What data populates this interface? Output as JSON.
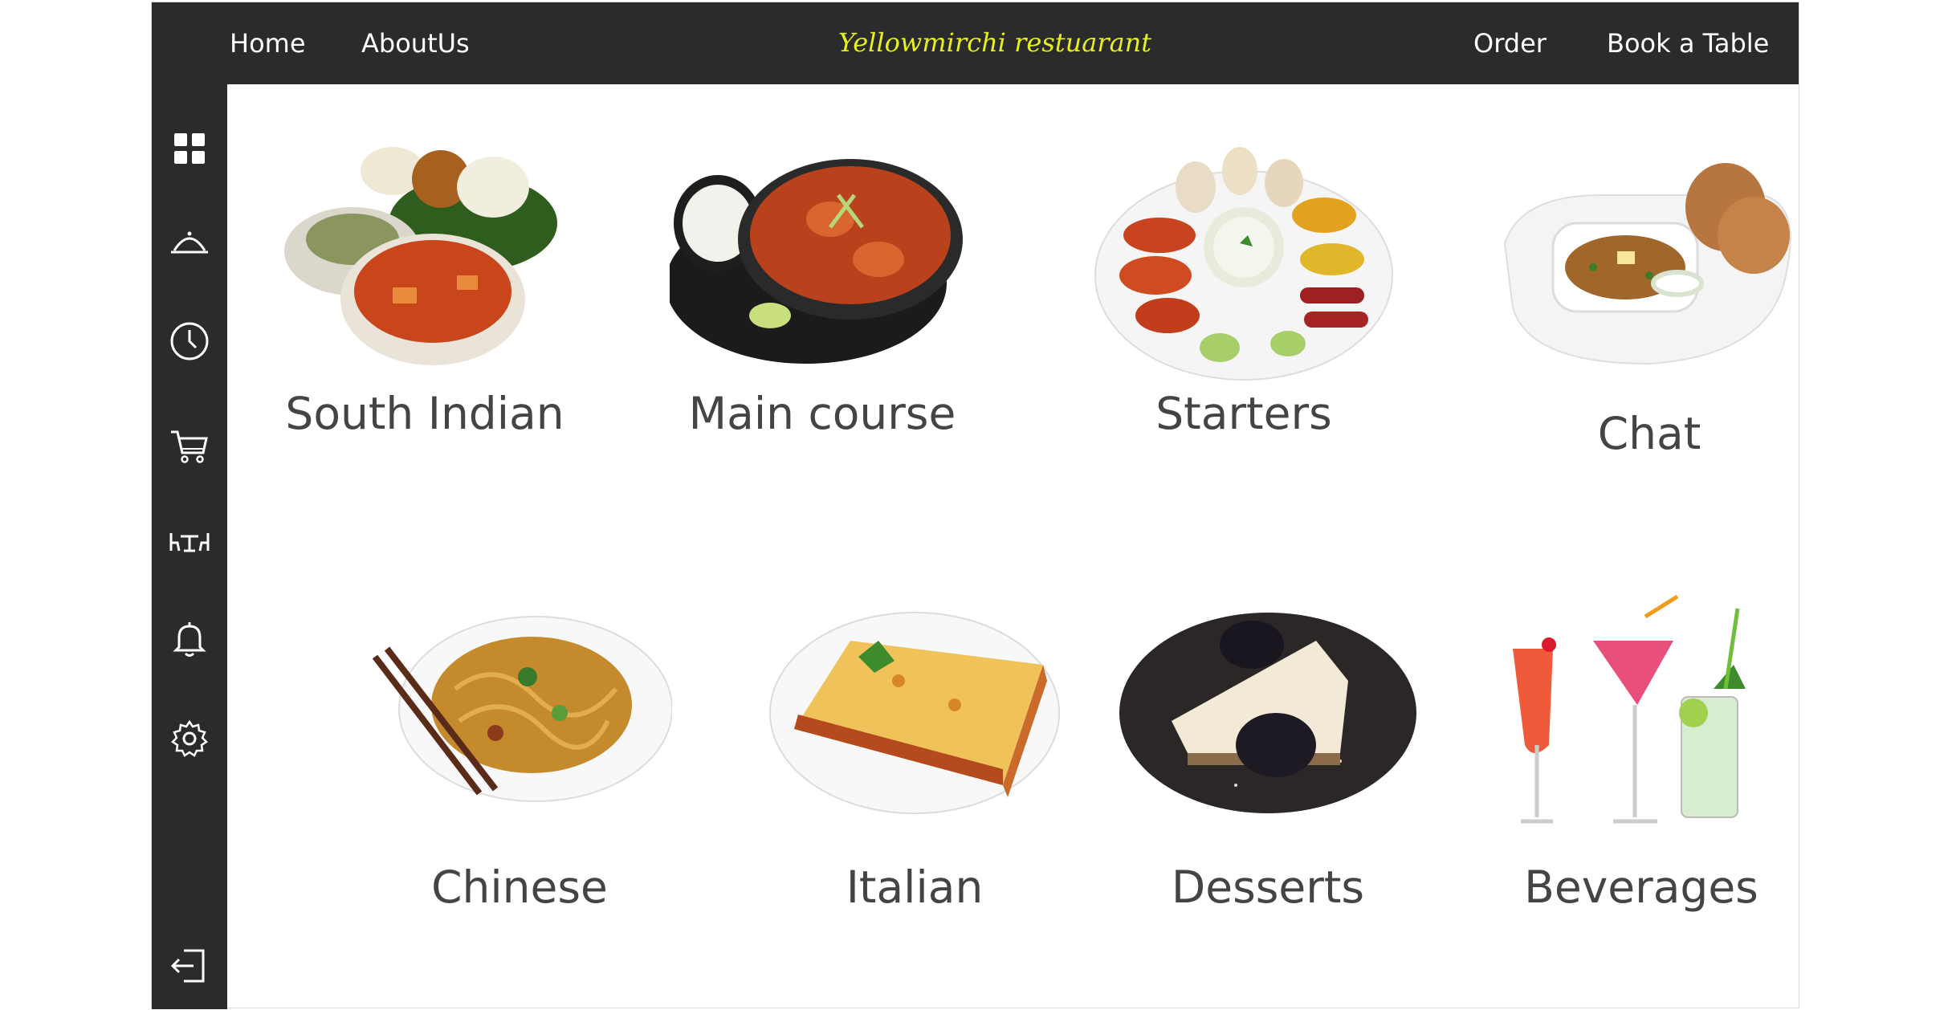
{
  "topbar": {
    "left_links": [
      "Home",
      "AboutUs"
    ],
    "brand": "Yellowmirchi restuarant",
    "right_links": [
      "Order",
      "Book a Table"
    ]
  },
  "sidebar": {
    "icons": [
      "grid-icon",
      "cloche-icon",
      "clock-icon",
      "cart-icon",
      "table-icon",
      "bell-icon",
      "gear-icon"
    ],
    "bottom_icon": "sign-out-icon"
  },
  "menu": {
    "categories": [
      {
        "label": "South Indian",
        "image": "south-indian-dish-image"
      },
      {
        "label": "Main course",
        "image": "main-course-curry-image"
      },
      {
        "label": "Starters",
        "image": "starters-platter-image"
      },
      {
        "label": "Chat",
        "image": "chat-pav-bhaji-image"
      },
      {
        "label": "Chinese",
        "image": "chinese-noodles-image"
      },
      {
        "label": "Italian",
        "image": "italian-lasagna-image"
      },
      {
        "label": "Desserts",
        "image": "dessert-cheesecake-image"
      },
      {
        "label": "Beverages",
        "image": "beverages-cocktails-image"
      }
    ]
  },
  "colors": {
    "bar": "#2b2b2b",
    "brand": "#e6ef1f",
    "nav_text": "#ffffff",
    "label_text": "#444444"
  }
}
